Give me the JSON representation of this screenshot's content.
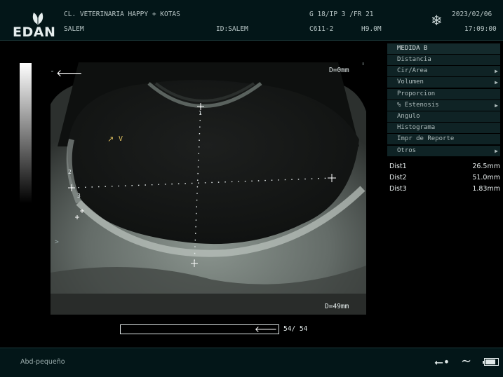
{
  "header": {
    "brand": "EDAN",
    "clinic": "CL. VETERINARIA HAPPY + KOTAS",
    "patient": "SALEM",
    "patient_id": "ID:SALEM",
    "imaging_params": "G 18/IP 3 /FR 21",
    "probe": "C611-2",
    "frequency": "H9.0M",
    "date": "2023/02/06",
    "time": "17:09:00",
    "freeze_icon": "snowflake-icon"
  },
  "image": {
    "depth_top": "D=0mm",
    "depth_bottom": "D=49mm",
    "cine_frames": "54/ 54",
    "cine_progress": 1.0,
    "caliper_labels": [
      "1",
      "2",
      "3"
    ],
    "orientation_mark": "V",
    "focus_mark": ">"
  },
  "menu": {
    "title": "MEDIDA B",
    "items": [
      {
        "label": "Distancia",
        "submenu": false
      },
      {
        "label": "Cir/Area",
        "submenu": true
      },
      {
        "label": "Volumen",
        "submenu": true
      },
      {
        "label": "Proporcion",
        "submenu": false
      },
      {
        "label": "% Estenosis",
        "submenu": true
      },
      {
        "label": "Angulo",
        "submenu": false
      },
      {
        "label": "Histograma",
        "submenu": false
      },
      {
        "label": "Impr de Reporte",
        "submenu": false
      },
      {
        "label": "Otros",
        "submenu": true
      }
    ]
  },
  "measurements": [
    {
      "label": "Dist1",
      "value": "26.5mm"
    },
    {
      "label": "Dist2",
      "value": "51.0mm"
    },
    {
      "label": "Dist3",
      "value": "1.83mm"
    }
  ],
  "footer": {
    "preset": "Abd-pequeño",
    "usb_icon": "usb-icon",
    "ac_icon": "ac-power-icon",
    "battery_icon": "battery-icon",
    "battery_level": 0.85
  }
}
